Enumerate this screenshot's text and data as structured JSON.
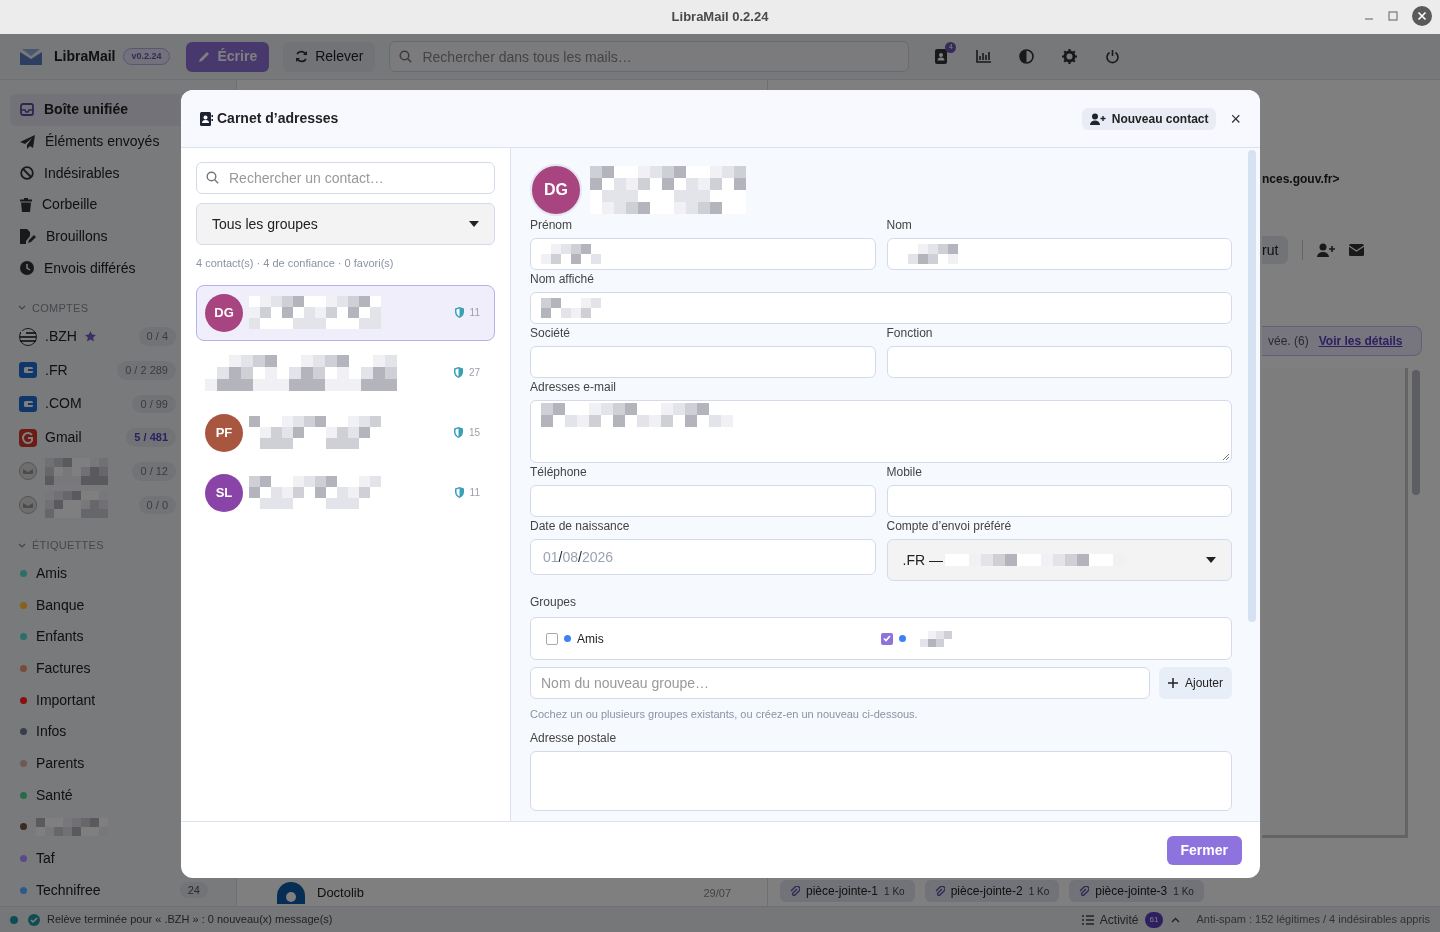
{
  "window": {
    "title": "LibraMail 0.2.24"
  },
  "toolbar": {
    "app_name": "LibraMail",
    "version": "v0.2.24",
    "compose_button": "Écrire",
    "fetch_button": "Relever",
    "search": {
      "placeholder": "Rechercher dans tous les mails…"
    },
    "contacts_badge": "4"
  },
  "sidebar": {
    "folders": [
      {
        "label": "Boîte unifiée",
        "kind": "inbox",
        "selected": true
      },
      {
        "label": "Éléments envoyés",
        "kind": "send",
        "selected": false
      },
      {
        "label": "Indésirables",
        "kind": "ban",
        "selected": false
      },
      {
        "label": "Corbeille",
        "kind": "trash",
        "selected": false
      },
      {
        "label": "Brouillons",
        "kind": "draft",
        "selected": false
      },
      {
        "label": "Envois différés",
        "kind": "clock",
        "selected": false
      }
    ],
    "accounts_heading": "COMPTES",
    "accounts": [
      {
        "label": ".BZH",
        "kind": "flag",
        "favorite": true,
        "count": "0 / 4",
        "unread": false
      },
      {
        "label": ".FR",
        "kind": "provider",
        "favorite": false,
        "count": "0 / 2 289",
        "unread": false
      },
      {
        "label": ".COM",
        "kind": "provider",
        "favorite": false,
        "count": "0 / 99",
        "unread": false
      },
      {
        "label": "Gmail",
        "kind": "gmail",
        "favorite": false,
        "count": "5 / 481",
        "unread": true
      },
      {
        "kind": "mail",
        "redacted": true,
        "favorite": false,
        "count": "0 / 12",
        "unread": false
      },
      {
        "kind": "mail",
        "redacted": true,
        "favorite": false,
        "count": "0 / 0",
        "unread": false
      }
    ],
    "labels_heading": "ÉTIQUETTES",
    "labels": [
      {
        "label": "Amis",
        "color": "#2e6e6a"
      },
      {
        "label": "Banque",
        "color": "#8a6018"
      },
      {
        "label": "Enfants",
        "color": "#2e6e6a"
      },
      {
        "label": "Factures",
        "color": "#7a4a3a"
      },
      {
        "label": "Important",
        "color": "#8a1010"
      },
      {
        "label": "Infos",
        "color": "#3a3e48"
      },
      {
        "label": "Parents",
        "color": "#6e5a52"
      },
      {
        "label": "Santé",
        "color": "#2a6a48"
      },
      {
        "redacted": true,
        "color": "#3a2a22"
      },
      {
        "label": "Taf",
        "color": "#5a4a8a"
      },
      {
        "label": "Technifree",
        "color": "#2e5a8a",
        "count": "24"
      }
    ]
  },
  "message_list": {
    "items": [
      {
        "sender": "Doctolib",
        "date": "29/07"
      }
    ]
  },
  "reader": {
    "sender_address": "nces.gouv.fr>",
    "button": "rut",
    "banner_text": "vée. (6)",
    "banner_link": "Voir les détails",
    "attachments": [
      {
        "name": "pièce-jointe-1",
        "size": "1 Ko"
      },
      {
        "name": "pièce-jointe-2",
        "size": "1 Ko"
      },
      {
        "name": "pièce-jointe-3",
        "size": "1 Ko"
      }
    ]
  },
  "status_bar": {
    "message": "Relève terminée pour « .BZH » : 0 nouveau(x) message(s)",
    "activity_label": "Activité",
    "activity_count": "61",
    "antispam": "Anti-spam : 152 légitimes / 4 indésirables appris"
  },
  "address_book": {
    "title": "Carnet d’adresses",
    "new_contact_button": "Nouveau contact",
    "close_icon": "×",
    "search": {
      "placeholder": "Rechercher un contact…"
    },
    "group_filter": "Tous les groupes",
    "stats": "4 contact(s) · 4 de confiance · 0 favori(s)",
    "contacts": [
      {
        "initials": "DG",
        "color": "#a8447f",
        "trust_count": "11",
        "selected": true
      },
      {
        "trust_count": "27",
        "selected": false
      },
      {
        "initials": "PF",
        "color": "#a85640",
        "trust_count": "15",
        "selected": false
      },
      {
        "initials": "SL",
        "color": "#8a44a8",
        "trust_count": "11",
        "selected": false
      }
    ],
    "contact_form": {
      "avatar": {
        "initials": "DG",
        "color": "#a8447f"
      },
      "rows": [
        {
          "fields": [
            {
              "label": "Prénom",
              "kind": "text",
              "redacted": true
            },
            {
              "label": "Nom",
              "kind": "text",
              "redacted": true
            }
          ]
        },
        {
          "fields": [
            {
              "label": "Nom affiché",
              "kind": "text",
              "redacted": true
            }
          ]
        },
        {
          "fields": [
            {
              "label": "Société",
              "kind": "text"
            },
            {
              "label": "Fonction",
              "kind": "text"
            }
          ]
        },
        {
          "fields": [
            {
              "label": "Adresses e-mail",
              "kind": "textarea",
              "redacted": true
            }
          ]
        },
        {
          "fields": [
            {
              "label": "Téléphone",
              "kind": "text"
            },
            {
              "label": "Mobile",
              "kind": "text"
            }
          ]
        },
        {
          "fields": [
            {
              "label": "Date de naissance",
              "kind": "date",
              "value": "01/08/2026"
            },
            {
              "label": "Compte d’envoi préféré",
              "kind": "select",
              "value": ".FR —",
              "redacted": true
            }
          ]
        }
      ],
      "groups": {
        "label": "Groupes",
        "items": [
          {
            "label": "Amis",
            "checked": false,
            "color": "#3b82f6"
          },
          {
            "redacted": true,
            "checked": true,
            "color": "#3b82f6"
          }
        ],
        "new_group": {
          "placeholder": "Nom du nouveau groupe…"
        },
        "add_button": "Ajouter",
        "hint": "Cochez un ou plusieurs groupes existants, ou créez-en un nouveau ci-dessous."
      },
      "postal_address": {
        "label": "Adresse postale"
      }
    },
    "close_button": "Fermer"
  }
}
